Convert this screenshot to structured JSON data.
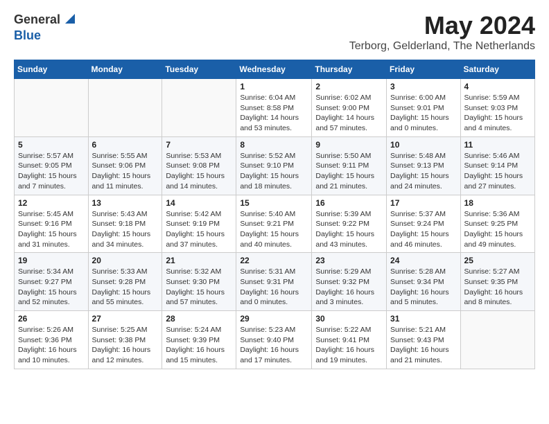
{
  "header": {
    "logo_general": "General",
    "logo_blue": "Blue",
    "month_year": "May 2024",
    "location": "Terborg, Gelderland, The Netherlands"
  },
  "days_of_week": [
    "Sunday",
    "Monday",
    "Tuesday",
    "Wednesday",
    "Thursday",
    "Friday",
    "Saturday"
  ],
  "weeks": [
    [
      {
        "day": "",
        "info": ""
      },
      {
        "day": "",
        "info": ""
      },
      {
        "day": "",
        "info": ""
      },
      {
        "day": "1",
        "info": "Sunrise: 6:04 AM\nSunset: 8:58 PM\nDaylight: 14 hours\nand 53 minutes."
      },
      {
        "day": "2",
        "info": "Sunrise: 6:02 AM\nSunset: 9:00 PM\nDaylight: 14 hours\nand 57 minutes."
      },
      {
        "day": "3",
        "info": "Sunrise: 6:00 AM\nSunset: 9:01 PM\nDaylight: 15 hours\nand 0 minutes."
      },
      {
        "day": "4",
        "info": "Sunrise: 5:59 AM\nSunset: 9:03 PM\nDaylight: 15 hours\nand 4 minutes."
      }
    ],
    [
      {
        "day": "5",
        "info": "Sunrise: 5:57 AM\nSunset: 9:05 PM\nDaylight: 15 hours\nand 7 minutes."
      },
      {
        "day": "6",
        "info": "Sunrise: 5:55 AM\nSunset: 9:06 PM\nDaylight: 15 hours\nand 11 minutes."
      },
      {
        "day": "7",
        "info": "Sunrise: 5:53 AM\nSunset: 9:08 PM\nDaylight: 15 hours\nand 14 minutes."
      },
      {
        "day": "8",
        "info": "Sunrise: 5:52 AM\nSunset: 9:10 PM\nDaylight: 15 hours\nand 18 minutes."
      },
      {
        "day": "9",
        "info": "Sunrise: 5:50 AM\nSunset: 9:11 PM\nDaylight: 15 hours\nand 21 minutes."
      },
      {
        "day": "10",
        "info": "Sunrise: 5:48 AM\nSunset: 9:13 PM\nDaylight: 15 hours\nand 24 minutes."
      },
      {
        "day": "11",
        "info": "Sunrise: 5:46 AM\nSunset: 9:14 PM\nDaylight: 15 hours\nand 27 minutes."
      }
    ],
    [
      {
        "day": "12",
        "info": "Sunrise: 5:45 AM\nSunset: 9:16 PM\nDaylight: 15 hours\nand 31 minutes."
      },
      {
        "day": "13",
        "info": "Sunrise: 5:43 AM\nSunset: 9:18 PM\nDaylight: 15 hours\nand 34 minutes."
      },
      {
        "day": "14",
        "info": "Sunrise: 5:42 AM\nSunset: 9:19 PM\nDaylight: 15 hours\nand 37 minutes."
      },
      {
        "day": "15",
        "info": "Sunrise: 5:40 AM\nSunset: 9:21 PM\nDaylight: 15 hours\nand 40 minutes."
      },
      {
        "day": "16",
        "info": "Sunrise: 5:39 AM\nSunset: 9:22 PM\nDaylight: 15 hours\nand 43 minutes."
      },
      {
        "day": "17",
        "info": "Sunrise: 5:37 AM\nSunset: 9:24 PM\nDaylight: 15 hours\nand 46 minutes."
      },
      {
        "day": "18",
        "info": "Sunrise: 5:36 AM\nSunset: 9:25 PM\nDaylight: 15 hours\nand 49 minutes."
      }
    ],
    [
      {
        "day": "19",
        "info": "Sunrise: 5:34 AM\nSunset: 9:27 PM\nDaylight: 15 hours\nand 52 minutes."
      },
      {
        "day": "20",
        "info": "Sunrise: 5:33 AM\nSunset: 9:28 PM\nDaylight: 15 hours\nand 55 minutes."
      },
      {
        "day": "21",
        "info": "Sunrise: 5:32 AM\nSunset: 9:30 PM\nDaylight: 15 hours\nand 57 minutes."
      },
      {
        "day": "22",
        "info": "Sunrise: 5:31 AM\nSunset: 9:31 PM\nDaylight: 16 hours\nand 0 minutes."
      },
      {
        "day": "23",
        "info": "Sunrise: 5:29 AM\nSunset: 9:32 PM\nDaylight: 16 hours\nand 3 minutes."
      },
      {
        "day": "24",
        "info": "Sunrise: 5:28 AM\nSunset: 9:34 PM\nDaylight: 16 hours\nand 5 minutes."
      },
      {
        "day": "25",
        "info": "Sunrise: 5:27 AM\nSunset: 9:35 PM\nDaylight: 16 hours\nand 8 minutes."
      }
    ],
    [
      {
        "day": "26",
        "info": "Sunrise: 5:26 AM\nSunset: 9:36 PM\nDaylight: 16 hours\nand 10 minutes."
      },
      {
        "day": "27",
        "info": "Sunrise: 5:25 AM\nSunset: 9:38 PM\nDaylight: 16 hours\nand 12 minutes."
      },
      {
        "day": "28",
        "info": "Sunrise: 5:24 AM\nSunset: 9:39 PM\nDaylight: 16 hours\nand 15 minutes."
      },
      {
        "day": "29",
        "info": "Sunrise: 5:23 AM\nSunset: 9:40 PM\nDaylight: 16 hours\nand 17 minutes."
      },
      {
        "day": "30",
        "info": "Sunrise: 5:22 AM\nSunset: 9:41 PM\nDaylight: 16 hours\nand 19 minutes."
      },
      {
        "day": "31",
        "info": "Sunrise: 5:21 AM\nSunset: 9:43 PM\nDaylight: 16 hours\nand 21 minutes."
      },
      {
        "day": "",
        "info": ""
      }
    ]
  ]
}
